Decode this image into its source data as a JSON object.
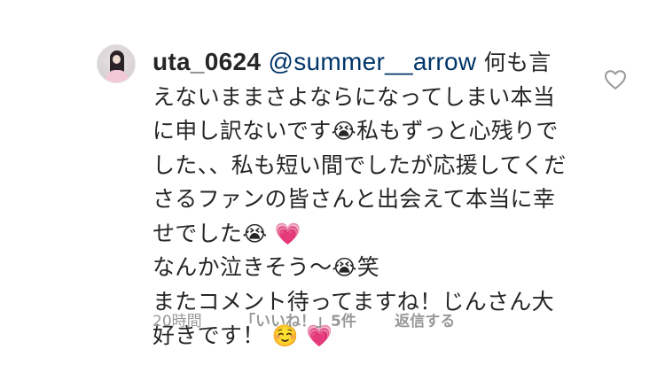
{
  "comment": {
    "username": "uta_0624",
    "mention": "@summer__arrow",
    "text_lines": [
      "何も言えないまま さよならになってしまい本当に申し訳ないです",
      "😭",
      "私もずっと心残りでした、、私も短い間でしたが応援してくださるファンの皆さんと出会えて本当に幸せでした",
      "😭 💗"
    ],
    "part1": "何も言えないままさよならになってしまい本当に申し訳ないです",
    "emoji1": "😭",
    "part2": "私もずっと心残りでした、、私も短い間でしたが応援してくださるファンの皆さんと出会えて本当に幸せでした",
    "emoji2": "😭",
    "emoji3": "💗",
    "line2_text": "なんか泣きそう〜",
    "line2_emoji": "😭",
    "line2_suffix": "笑",
    "line3_text": "またコメント待ってますね！じんさん大好きです！",
    "line3_emoji1": "☺️",
    "line3_emoji2": "💗",
    "timestamp": "20時間",
    "likes": "「いいね！」5件",
    "reply": "返信する"
  },
  "icons": {
    "like": "heart-outline-icon",
    "avatar": "profile-photo"
  },
  "colors": {
    "text": "#262626",
    "mention": "#003569",
    "meta": "#999999",
    "heart_stroke": "#999999"
  }
}
